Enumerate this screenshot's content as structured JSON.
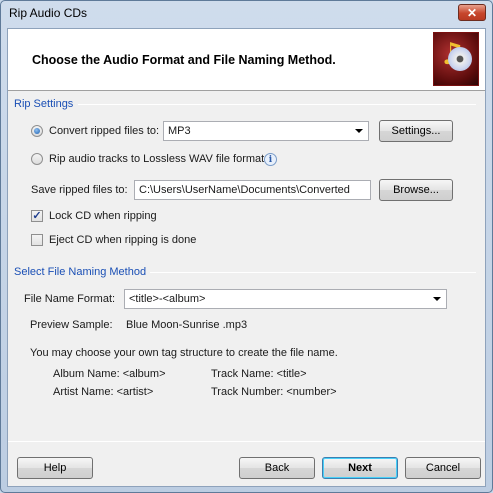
{
  "window": {
    "title": "Rip Audio CDs",
    "close_glyph": "✕"
  },
  "header": {
    "title": "Choose the Audio Format and File Naming Method.",
    "art_icon": "music-cd-icon"
  },
  "rip_settings": {
    "section_label": "Rip Settings",
    "convert_label": "Convert ripped files to:",
    "format_value": "MP3",
    "settings_button": "Settings...",
    "lossless_label": "Rip audio tracks to Lossless WAV file format",
    "save_label": "Save ripped files to:",
    "save_path": "C:\\Users\\UserName\\Documents\\Converted",
    "browse_button": "Browse...",
    "lock_cd_label": "Lock CD when ripping",
    "lock_cd_checked": true,
    "eject_cd_label": "Eject CD when ripping is done",
    "eject_cd_checked": false,
    "convert_selected": true
  },
  "naming": {
    "section_label": "Select File Naming Method",
    "format_label": "File Name Format:",
    "format_value": "<title>-<album>",
    "preview_label": "Preview Sample:",
    "preview_value": "Blue Moon-Sunrise .mp3",
    "hint": "You may choose your own tag structure to create the file name.",
    "tags": {
      "album": "Album Name: <album>",
      "artist": "Artist Name: <artist>",
      "track_name": "Track Name: <title>",
      "track_number": "Track Number: <number>"
    }
  },
  "footer": {
    "help": "Help",
    "back": "Back",
    "next": "Next",
    "cancel": "Cancel"
  },
  "colors": {
    "section_label": "#1a4fb5",
    "close_button": "#c7462c"
  }
}
